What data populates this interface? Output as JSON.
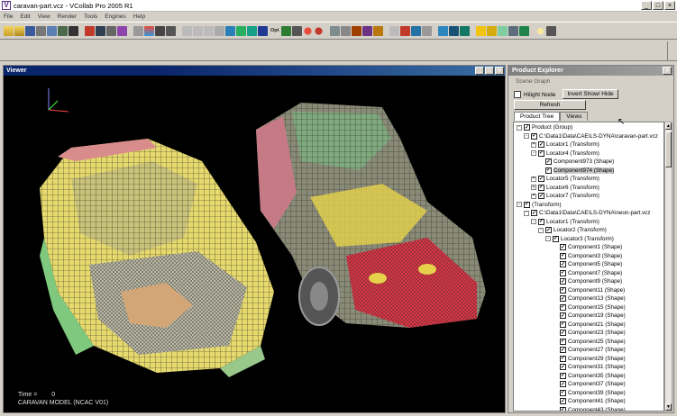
{
  "window": {
    "title": "caravan-part.vcz - VCollab Pro 2005 R1",
    "app_icon": "V",
    "controls": [
      "_",
      "□",
      "×"
    ]
  },
  "menu": [
    "File",
    "Edit",
    "View",
    "Render",
    "Tools",
    "Engines",
    "Help"
  ],
  "toolbar": {
    "opt_label": "Opt"
  },
  "viewer": {
    "title": "Viewer",
    "controls": [
      "_",
      "□",
      "×"
    ],
    "time_label": "Time =",
    "time_value": "0",
    "model_label": "CARAVAN MODEL (NCAC V01)"
  },
  "explorer": {
    "title": "Product Explorer",
    "close": "×",
    "subtitle": "Scene Graph",
    "hilight_label": "Hilight Node",
    "invert_label": "Invert Show/ Hide",
    "refresh_label": "Refresh",
    "tabs": [
      "Product Tree",
      "Views"
    ],
    "scroll_up": "▲",
    "scroll_down": "▼"
  },
  "tree": [
    {
      "label": "Product (Group)",
      "exp": "-",
      "checked": true
    },
    {
      "label": "C:\\Data1\\Data\\CAE\\LS-DYNA\\caravan-part.vcz",
      "exp": "-",
      "checked": true
    },
    {
      "label": "Locator1 (Transform)",
      "exp": "+",
      "checked": true
    },
    {
      "label": "Locator4 (Transform)",
      "exp": "-",
      "checked": true
    },
    {
      "label": "Component973 (Shape)",
      "exp": "",
      "checked": true
    },
    {
      "label": "Component974 (Shape)",
      "exp": "",
      "checked": true,
      "selected": true
    },
    {
      "label": "Locator5 (Transform)",
      "exp": "+",
      "checked": true
    },
    {
      "label": "Locator6 (Transform)",
      "exp": "+",
      "checked": true
    },
    {
      "label": "Locator7 (Transform)",
      "exp": "+",
      "checked": true
    },
    {
      "label": "(Transform)",
      "exp": "-",
      "checked": true
    },
    {
      "label": "C:\\Data1\\Data\\CAE\\LS-DYNA\\neon-part.vcz",
      "exp": "-",
      "checked": true
    },
    {
      "label": "Locator1 (Transform)",
      "exp": "-",
      "checked": true
    },
    {
      "label": "Locator2 (Transform)",
      "exp": "-",
      "checked": true
    },
    {
      "label": "Locator3 (Transform)",
      "exp": "-",
      "checked": true
    },
    {
      "label": "Component1 (Shape)",
      "exp": "",
      "checked": true
    },
    {
      "label": "Component3 (Shape)",
      "exp": "",
      "checked": true
    },
    {
      "label": "Component5 (Shape)",
      "exp": "",
      "checked": true
    },
    {
      "label": "Component7 (Shape)",
      "exp": "",
      "checked": true
    },
    {
      "label": "Component9 (Shape)",
      "exp": "",
      "checked": true
    },
    {
      "label": "Component11 (Shape)",
      "exp": "",
      "checked": true
    },
    {
      "label": "Component13 (Shape)",
      "exp": "",
      "checked": true
    },
    {
      "label": "Component15 (Shape)",
      "exp": "",
      "checked": true
    },
    {
      "label": "Component19 (Shape)",
      "exp": "",
      "checked": true
    },
    {
      "label": "Component21 (Shape)",
      "exp": "",
      "checked": true
    },
    {
      "label": "Component23 (Shape)",
      "exp": "",
      "checked": true
    },
    {
      "label": "Component25 (Shape)",
      "exp": "",
      "checked": true
    },
    {
      "label": "Component27 (Shape)",
      "exp": "",
      "checked": true
    },
    {
      "label": "Component29 (Shape)",
      "exp": "",
      "checked": true
    },
    {
      "label": "Component31 (Shape)",
      "exp": "",
      "checked": true
    },
    {
      "label": "Component35 (Shape)",
      "exp": "",
      "checked": true
    },
    {
      "label": "Component37 (Shape)",
      "exp": "",
      "checked": true
    },
    {
      "label": "Component39 (Shape)",
      "exp": "",
      "checked": true
    },
    {
      "label": "Component41 (Shape)",
      "exp": "",
      "checked": true
    },
    {
      "label": "Component43 (Shape)",
      "exp": "",
      "checked": true
    }
  ],
  "colors": {
    "viewer_title": "#0a246a",
    "explorer_title": "#808080",
    "mesh_yellow": "#e6d24a",
    "mesh_green": "#7fc97f",
    "mesh_red": "#d9364a",
    "mesh_gray": "#9a9a8a"
  }
}
